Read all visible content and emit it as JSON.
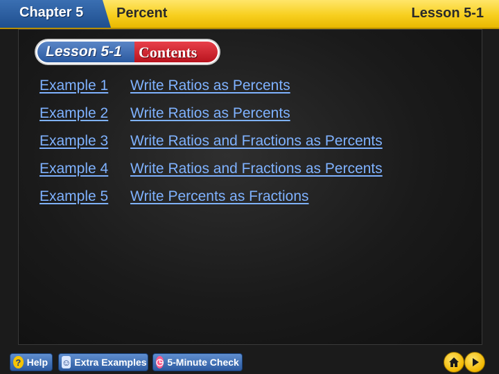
{
  "header": {
    "chapter_label": "Chapter 5",
    "chapter_title": "Percent",
    "lesson_number": "Lesson 5-1"
  },
  "badge": {
    "lesson": "Lesson 5-1",
    "contents": "Contents"
  },
  "examples": [
    {
      "label": "Example 1",
      "title": "Write Ratios as Percents"
    },
    {
      "label": "Example 2",
      "title": "Write Ratios as Percents"
    },
    {
      "label": "Example 3",
      "title": "Write Ratios and Fractions as Percents"
    },
    {
      "label": "Example 4",
      "title": "Write Ratios and Fractions as Percents"
    },
    {
      "label": "Example 5",
      "title": "Write Percents as Fractions"
    }
  ],
  "toolbar": {
    "help_label": "Help",
    "extra_examples_label": "Extra Examples",
    "five_minute_check_label": "5-Minute Check"
  },
  "colors": {
    "link": "#7fb2ff",
    "header_yellow": "#f7cf1f",
    "chapter_blue": "#1f4f8f",
    "contents_red": "#b8141e"
  },
  "icons": {
    "help": "question-mark-icon",
    "extra_examples": "people-icon",
    "five_minute_check": "clock-icon",
    "home": "home-icon",
    "next": "play-arrow-icon"
  }
}
